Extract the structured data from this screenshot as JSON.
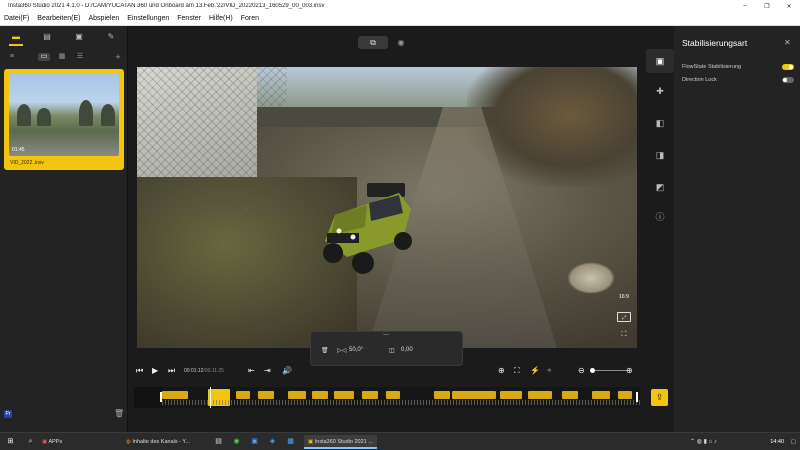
{
  "titlebar": {
    "title": "Insta360 Studio 2021 4.1.0 - D:/CAM/YUCATAN 360 und Onboard am 13.Feb.'22/VID_20220213_160529_00_003.insv",
    "minimize": "–",
    "maximize": "❐",
    "close": "✕"
  },
  "menu": [
    "Datei(F)",
    "Bearbeiten(E)",
    "Abspielen",
    "Einstellungen",
    "Fenster",
    "Hilfe(H)",
    "Foren"
  ],
  "library": {
    "tabs": [
      "media-icon",
      "project-icon",
      "folder-icon",
      "edit-icon"
    ],
    "add": "+",
    "clip": {
      "duration": "01:45",
      "name": "VID_2022..insv"
    }
  },
  "preview": {
    "edit_mode_icon": "⧉",
    "view_mode_icon": "◉",
    "aspect_ratio": "16:9",
    "fit_icon": "⤢",
    "fullscreen_icon": "⛶"
  },
  "keyframe_panel": {
    "value1": "50,0°",
    "value2": "0,00"
  },
  "playback": {
    "current_time": "00:01:12",
    "total_time": "/00:11:25"
  },
  "right_panel": {
    "title": "Stabilisierungsart",
    "close": "✕",
    "options": [
      {
        "label": "FlowState Stabilisierung",
        "enabled": true
      },
      {
        "label": "Direction Lock",
        "enabled": false
      }
    ]
  },
  "taskbar": {
    "items": [
      {
        "label": "APPs"
      },
      {
        "label": "Inhalte des Kanals - Y..."
      },
      {
        "label": "Insta360 Studio 2021 ..."
      }
    ],
    "clock": "14:40"
  },
  "colors": {
    "accent": "#f2c511",
    "panel": "#232323",
    "background": "#1b1b1b"
  }
}
